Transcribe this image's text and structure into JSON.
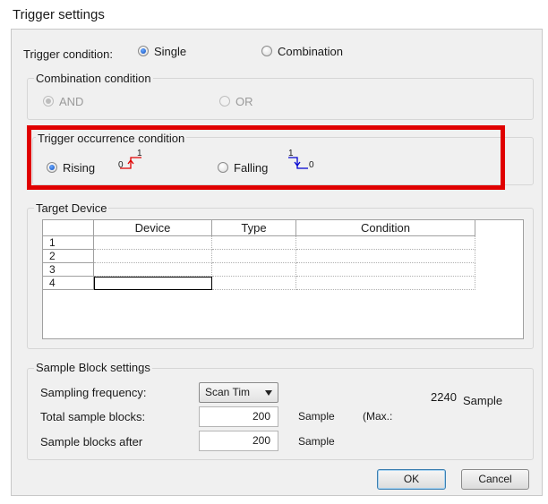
{
  "window": {
    "title": "Trigger settings"
  },
  "trigger_condition": {
    "label": "Trigger condition:",
    "single_label": "Single",
    "combination_label": "Combination",
    "selected": "Single"
  },
  "combination_condition": {
    "group_label": "Combination condition",
    "and_label": "AND",
    "or_label": "OR"
  },
  "occurrence_condition": {
    "group_label": "Trigger occurrence condition",
    "rising_label": "Rising",
    "falling_label": "Falling",
    "rising_marker": "1",
    "rising_marker_low": "0",
    "falling_marker": "1",
    "falling_marker_low": "0",
    "selected": "Rising",
    "rising_color": "#e00000",
    "falling_color": "#0000d0"
  },
  "target_device": {
    "group_label": "Target Device",
    "columns": [
      "",
      "Device",
      "Type",
      "Condition"
    ],
    "rows": [
      {
        "num": "1",
        "device": "",
        "type": "",
        "condition": ""
      },
      {
        "num": "2",
        "device": "",
        "type": "",
        "condition": ""
      },
      {
        "num": "3",
        "device": "",
        "type": "",
        "condition": ""
      },
      {
        "num": "4",
        "device": "",
        "type": "",
        "condition": ""
      }
    ]
  },
  "sample_block": {
    "group_label": "Sample Block settings",
    "sampling_frequency_label": "Sampling frequency:",
    "sampling_frequency_value": "Scan Tim",
    "total_blocks_label": "Total sample blocks:",
    "total_blocks_value": "200",
    "total_blocks_unit": "Sample",
    "max_label": "(Max.:",
    "max_value": "2240",
    "max_unit": "Sample",
    "after_label": "Sample blocks after",
    "after_value": "200",
    "after_unit": "Sample"
  },
  "buttons": {
    "ok": "OK",
    "cancel": "Cancel"
  },
  "highlight_color": "#e00000"
}
